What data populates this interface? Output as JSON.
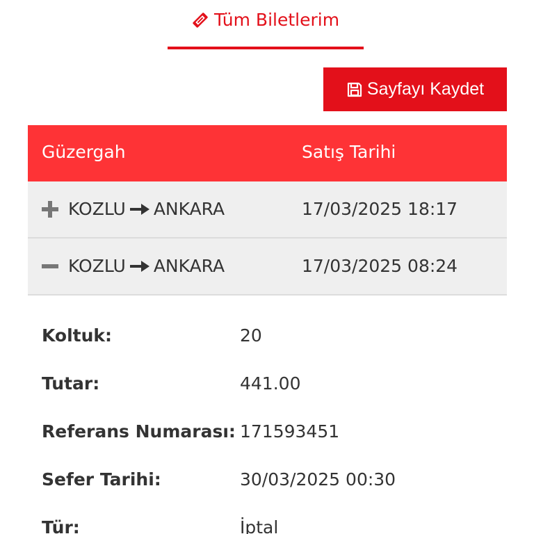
{
  "tab": {
    "label": "Tüm Biletlerim",
    "icon": "ticket-icon"
  },
  "toolbar": {
    "save_label": "Sayfayı Kaydet",
    "save_icon": "floppy-disk-icon"
  },
  "table": {
    "headers": {
      "route": "Güzergah",
      "sale_date": "Satış Tarihi"
    },
    "rows": [
      {
        "toggle": "plus",
        "from": "KOZLU",
        "to": "ANKARA",
        "sale_date": "17/03/2025 18:17",
        "expanded": false
      },
      {
        "toggle": "minus",
        "from": "KOZLU",
        "to": "ANKARA",
        "sale_date": "17/03/2025 08:24",
        "expanded": true
      }
    ]
  },
  "details": [
    {
      "label": "Koltuk:",
      "value": "20"
    },
    {
      "label": "Tutar:",
      "value": "441.00"
    },
    {
      "label": "Referans Numarası:",
      "value": "171593451"
    },
    {
      "label": "Sefer Tarihi:",
      "value": "30/03/2025 00:30"
    },
    {
      "label": "Tür:",
      "value": "İptal"
    }
  ],
  "colors": {
    "accent": "#e3101a",
    "header_bg": "#fe3336",
    "row_bg": "#efefef",
    "text": "#333333"
  }
}
